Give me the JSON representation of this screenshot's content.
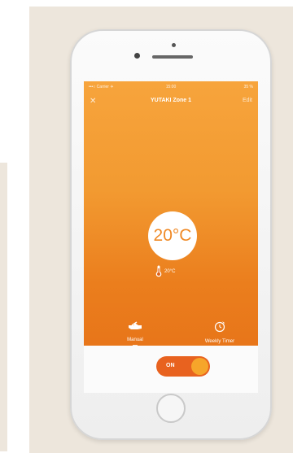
{
  "phone_screen": {
    "status_bar": {
      "carrier": "•••○ Carrier ✈",
      "time": "15:00",
      "battery": "35 %"
    },
    "header": {
      "close_icon": "close-icon",
      "title": "YUTAKI Zone 1",
      "edit_label": "Edit"
    },
    "temperature": {
      "setpoint": "20°C",
      "room_value": "20°C",
      "room_icon": "thermometer-icon"
    },
    "modes": [
      {
        "label": "Manual",
        "icon": "hand-icon",
        "selected": true
      },
      {
        "label": "Weekly Timer",
        "icon": "timer-icon",
        "selected": false
      }
    ],
    "power_toggle": {
      "label": "ON",
      "state": "on"
    }
  },
  "colors": {
    "screen_gradient_top": "#f7a43c",
    "screen_gradient_bottom": "#e56f17",
    "toggle_track": "#e8621f",
    "toggle_knob": "#f6a52a",
    "background": "#ede6dc"
  }
}
